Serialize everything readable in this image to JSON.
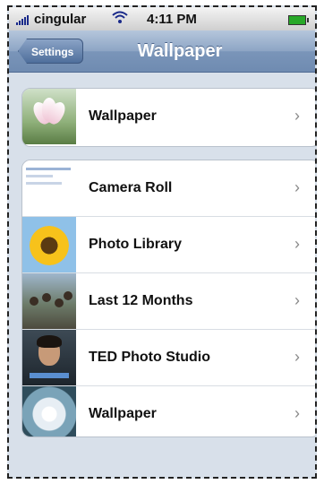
{
  "status_bar": {
    "carrier": "cingular",
    "time": "4:11 PM"
  },
  "nav": {
    "back_label": "Settings",
    "title": "Wallpaper"
  },
  "groups": [
    {
      "items": [
        {
          "label": "Wallpaper",
          "thumb": "lotus-thumbnail"
        }
      ]
    },
    {
      "items": [
        {
          "label": "Camera Roll",
          "thumb": "camera-roll-thumbnail"
        },
        {
          "label": "Photo Library",
          "thumb": "sunflower-thumbnail"
        },
        {
          "label": "Last 12 Months",
          "thumb": "crowd-thumbnail"
        },
        {
          "label": "TED Photo Studio",
          "thumb": "portrait-thumbnail"
        },
        {
          "label": "Wallpaper",
          "thumb": "flower-thumbnail"
        }
      ]
    }
  ],
  "chevron": "›"
}
